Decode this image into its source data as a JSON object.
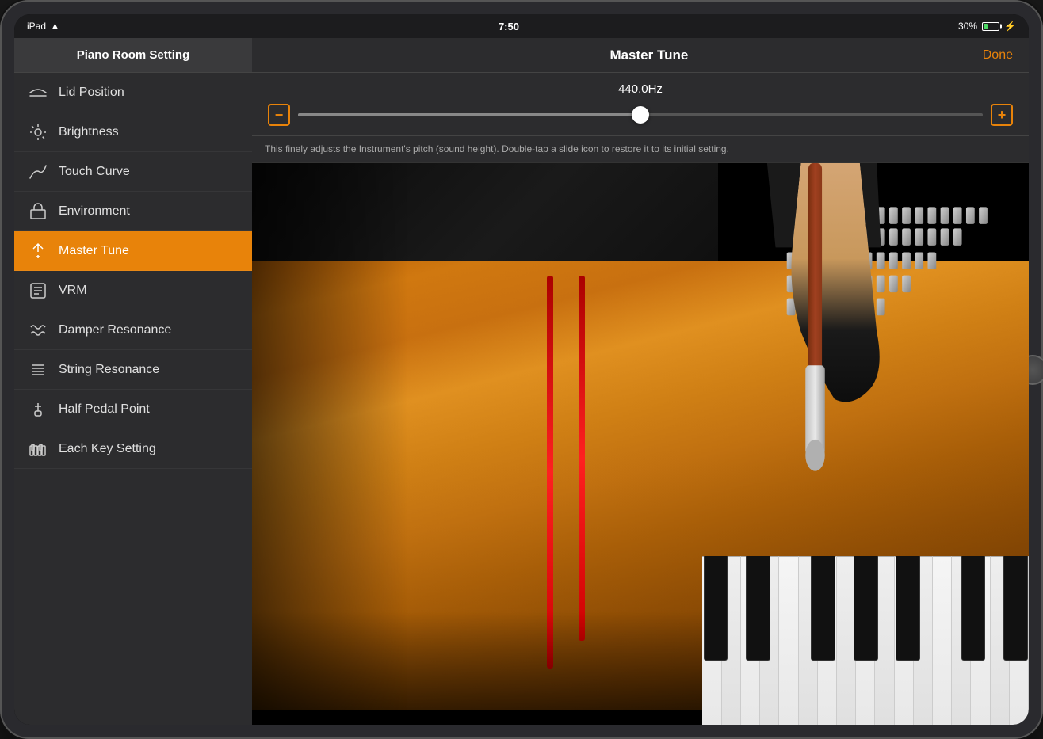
{
  "device": {
    "status_bar": {
      "device_name": "iPad",
      "time": "7:50",
      "battery_percent": "30%"
    }
  },
  "sidebar": {
    "title": "Piano Room Setting",
    "items": [
      {
        "id": "lid-position",
        "label": "Lid Position",
        "icon": "lid-icon"
      },
      {
        "id": "brightness",
        "label": "Brightness",
        "icon": "brightness-icon"
      },
      {
        "id": "touch-curve",
        "label": "Touch Curve",
        "icon": "touch-curve-icon"
      },
      {
        "id": "environment",
        "label": "Environment",
        "icon": "environment-icon"
      },
      {
        "id": "master-tune",
        "label": "Master Tune",
        "icon": "master-tune-icon",
        "active": true
      },
      {
        "id": "vrm",
        "label": "VRM",
        "icon": "vrm-icon"
      },
      {
        "id": "damper-resonance",
        "label": "Damper Resonance",
        "icon": "damper-icon"
      },
      {
        "id": "string-resonance",
        "label": "String Resonance",
        "icon": "string-icon"
      },
      {
        "id": "half-pedal-point",
        "label": "Half Pedal Point",
        "icon": "pedal-icon"
      },
      {
        "id": "each-key-setting",
        "label": "Each Key Setting",
        "icon": "key-setting-icon"
      }
    ]
  },
  "main": {
    "title": "Master Tune",
    "done_button": "Done",
    "tune_value": "440.0Hz",
    "description": "This finely adjusts the Instrument's pitch (sound height). Double-tap a slide icon to restore it to its initial setting.",
    "slider_min_icon": "minus",
    "slider_max_icon": "plus",
    "slider_value": 50
  }
}
